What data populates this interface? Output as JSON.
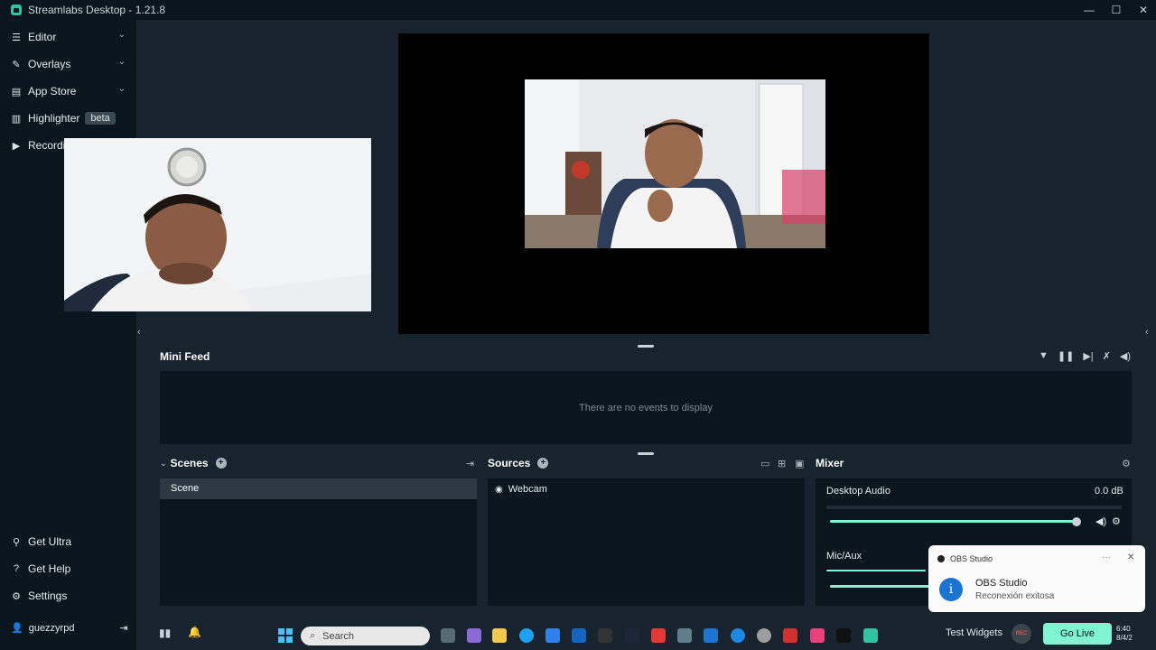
{
  "window": {
    "title": "Streamlabs Desktop - 1.21.8",
    "controls": {
      "minimize": "—",
      "maximize": "☐",
      "close": "✕"
    }
  },
  "sidebar": {
    "items": [
      {
        "label": "Editor",
        "icon": "sliders-icon",
        "glyph": "☰"
      },
      {
        "label": "Overlays",
        "icon": "overlay-icon",
        "glyph": "✎"
      },
      {
        "label": "App Store",
        "icon": "store-icon",
        "glyph": "▤"
      },
      {
        "label": "Highlighter",
        "icon": "highlighter-icon",
        "glyph": "▥",
        "badge": "beta"
      },
      {
        "label": "Recordin",
        "icon": "play-icon",
        "glyph": "▶"
      }
    ],
    "bottom_items": [
      {
        "label": "Get Ultra",
        "icon": "ultra-icon",
        "glyph": "⚲"
      },
      {
        "label": "Get Help",
        "icon": "help-icon",
        "glyph": "?"
      },
      {
        "label": "Settings",
        "icon": "gear-icon",
        "glyph": "⚙"
      }
    ],
    "user": {
      "name": "guezzyrpd",
      "logout_glyph": "⇥"
    }
  },
  "mini_feed": {
    "title": "Mini Feed",
    "empty_text": "There are no events to display"
  },
  "scenes": {
    "title": "Scenes",
    "items": [
      "Scene"
    ]
  },
  "sources": {
    "title": "Sources",
    "items": [
      {
        "label": "Webcam",
        "icon": "webcam-icon"
      }
    ]
  },
  "mixer": {
    "title": "Mixer",
    "channels": [
      {
        "name": "Desktop Audio",
        "level": "0.0 dB",
        "volume": 0.96
      },
      {
        "name": "Mic/Aux",
        "level": "",
        "volume": 0.96
      }
    ]
  },
  "notification": {
    "app": "OBS Studio",
    "title": "OBS Studio",
    "message": "Reconexión exitosa",
    "more": "···",
    "close": "✕"
  },
  "taskbar": {
    "search_placeholder": "Search",
    "test_widgets": "Test Widgets",
    "rec_label": "REC",
    "go_live": "Go Live",
    "clock_time": "6:40",
    "clock_date": "8/4/2"
  },
  "colors": {
    "accent": "#80f5d2",
    "sidebar_bg": "#09161d",
    "main_bg": "#17242d",
    "panel_bg": "#09161d"
  }
}
